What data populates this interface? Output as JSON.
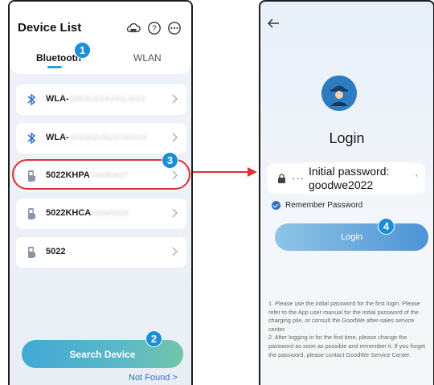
{
  "left_screen": {
    "header": {
      "title": "Device List",
      "icons": [
        "cloud-icon",
        "help-icon",
        "more-icon"
      ]
    },
    "tabs": [
      {
        "label": "Bluetooth",
        "active": true
      },
      {
        "label": "WLAN",
        "active": false
      }
    ],
    "devices": [
      {
        "type": "bluetooth",
        "name": "WLA-",
        "suffix": "53KSLEOA245L0013"
      },
      {
        "type": "bluetooth",
        "name": "WLA-",
        "suffix": "9015KEUB237W0019"
      },
      {
        "type": "charger",
        "name": "5022KHPA",
        "suffix": "246W0627"
      },
      {
        "type": "charger",
        "name": "5022KHCA",
        "suffix": "236W0026"
      },
      {
        "type": "charger",
        "name": "5022",
        "suffix": ""
      }
    ],
    "search_button": "Search Device",
    "not_found_link": "Not Found >"
  },
  "right_screen": {
    "title": "Login",
    "password_dots": "····",
    "password_callout": "Initial password: goodwe2022",
    "remember_label": "Remember Password",
    "login_button": "Login",
    "notes": "1. Please use the initial password for the first login. Please refer to the App user manual for the initial password of the charging pile, or consult the GoodWe after-sales service center.\n2. After logging in for the first time, please change the password as soon as possible and remember it. If you forget the password, please contact GoodWe Service Center."
  },
  "step_markers": [
    "1",
    "2",
    "3",
    "4"
  ],
  "colors": {
    "accent_blue": "#1c8ed8",
    "highlight_red": "#e02f34",
    "link_blue": "#2e6fcd"
  }
}
